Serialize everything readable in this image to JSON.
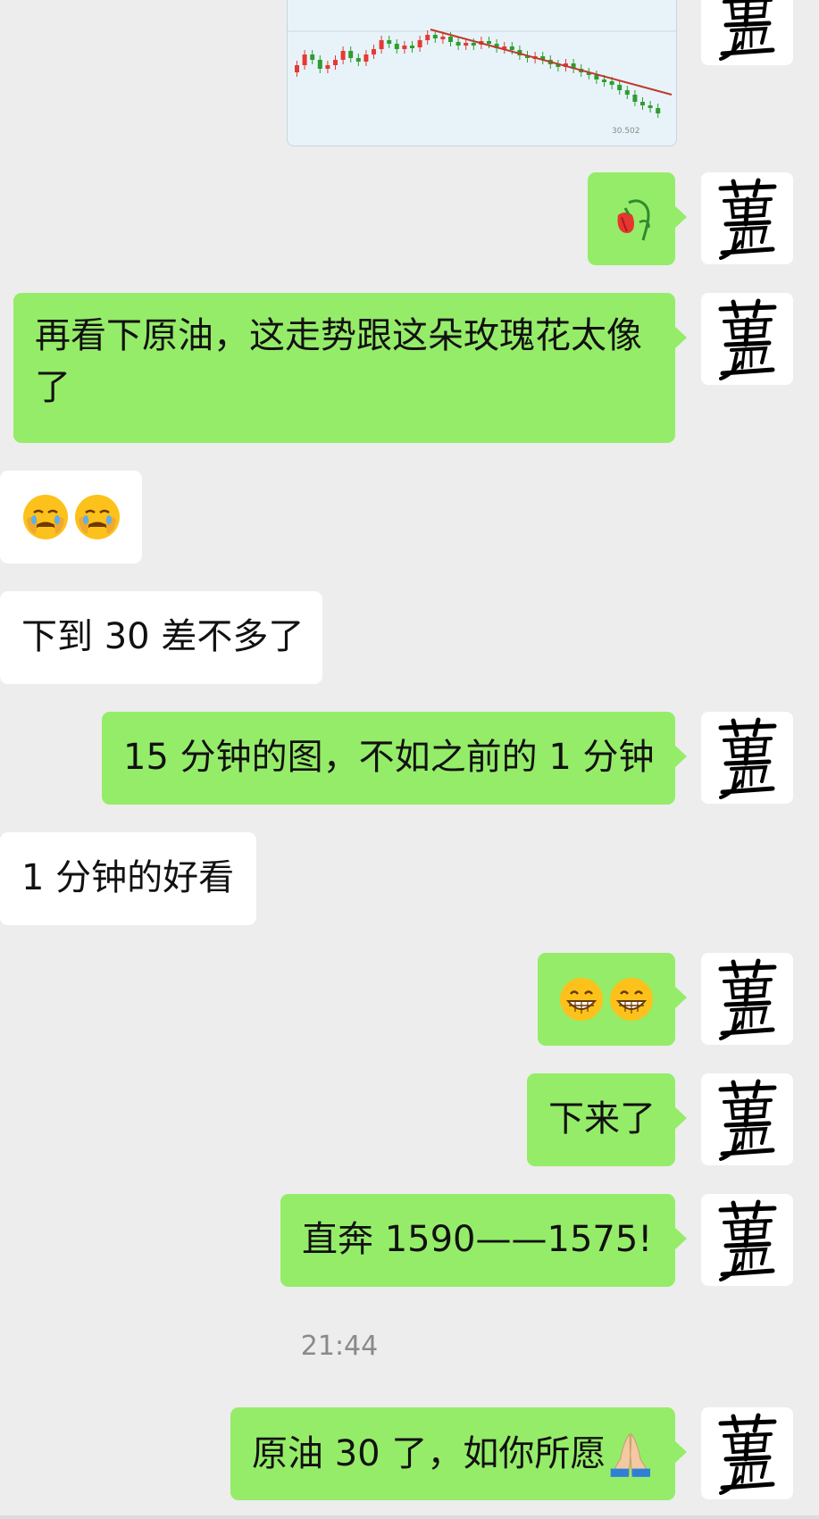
{
  "chat": {
    "messages": [
      {
        "side": "right",
        "kind": "image",
        "content": "candlestick-chart",
        "chart_label": "30.502"
      },
      {
        "side": "right",
        "kind": "emoji",
        "content": "wilted-rose-emoji"
      },
      {
        "side": "right",
        "kind": "text",
        "line1": "再看下原油，这走势跟这朵玫瑰花太像",
        "line2": "了"
      },
      {
        "side": "left",
        "kind": "emoji",
        "content": "crying-face-emoji x2"
      },
      {
        "side": "left",
        "kind": "text",
        "content": "下到 30 差不多了"
      },
      {
        "side": "right",
        "kind": "text",
        "content": "15 分钟的图，不如之前的 1 分钟"
      },
      {
        "side": "left",
        "kind": "text",
        "content": "1 分钟的好看"
      },
      {
        "side": "right",
        "kind": "emoji",
        "content": "grinning-face-emoji x2"
      },
      {
        "side": "right",
        "kind": "text",
        "content": "下来了"
      },
      {
        "side": "right",
        "kind": "text",
        "content": "直奔 1590——1575!"
      },
      {
        "side": "right",
        "kind": "text",
        "content": "原油 30 了，如你所愿",
        "suffix_icon": "folded-hands-emoji"
      }
    ],
    "timestamp": "21:44"
  },
  "avatar": {
    "glyph_name": "calligraphy-avatar",
    "color": "#000000"
  },
  "colors": {
    "sent_bubble": "#95ec69",
    "received_bubble": "#ffffff",
    "background": "#ededed",
    "trend_line": "#c0392b",
    "candle_up": "#e53935",
    "candle_down": "#2e9d2e"
  }
}
